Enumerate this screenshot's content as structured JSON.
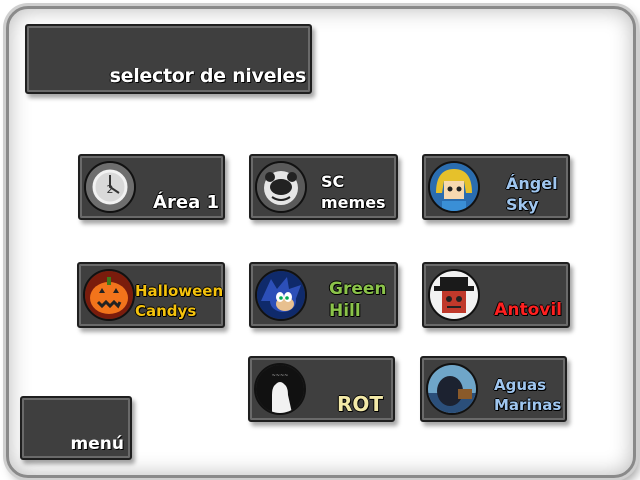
{
  "title": "selector de niveles",
  "menu_label": "menú",
  "levels": [
    {
      "label": "Área 1",
      "color": "#ffffff",
      "icon": "clock-icon"
    },
    {
      "label": "SC memes",
      "line1": "SC",
      "line2": "memes",
      "color": "#ffffff",
      "icon": "mouse-face-icon"
    },
    {
      "label": "Ángel Sky",
      "line1": "Ángel",
      "line2": "Sky",
      "color": "#9fc6ef",
      "icon": "blonde-character-icon"
    },
    {
      "label": "Halloween Candys",
      "line1": "Halloween",
      "line2": "Candys",
      "color": "#f4c20d",
      "icon": "pumpkin-icon"
    },
    {
      "label": "Green Hill",
      "line1": "Green",
      "line2": "Hill",
      "color": "#8bc34a",
      "icon": "hedgehog-icon"
    },
    {
      "label": "Antovil",
      "color": "#ff2020",
      "icon": "hat-character-icon"
    },
    {
      "label": "ROT",
      "color": "#f3e9a8",
      "icon": "silhouette-icon"
    },
    {
      "label": "Aguas Marinas",
      "line1": "Aguas",
      "line2": "Marinas",
      "color": "#9fc6ef",
      "icon": "sea-icon"
    }
  ]
}
